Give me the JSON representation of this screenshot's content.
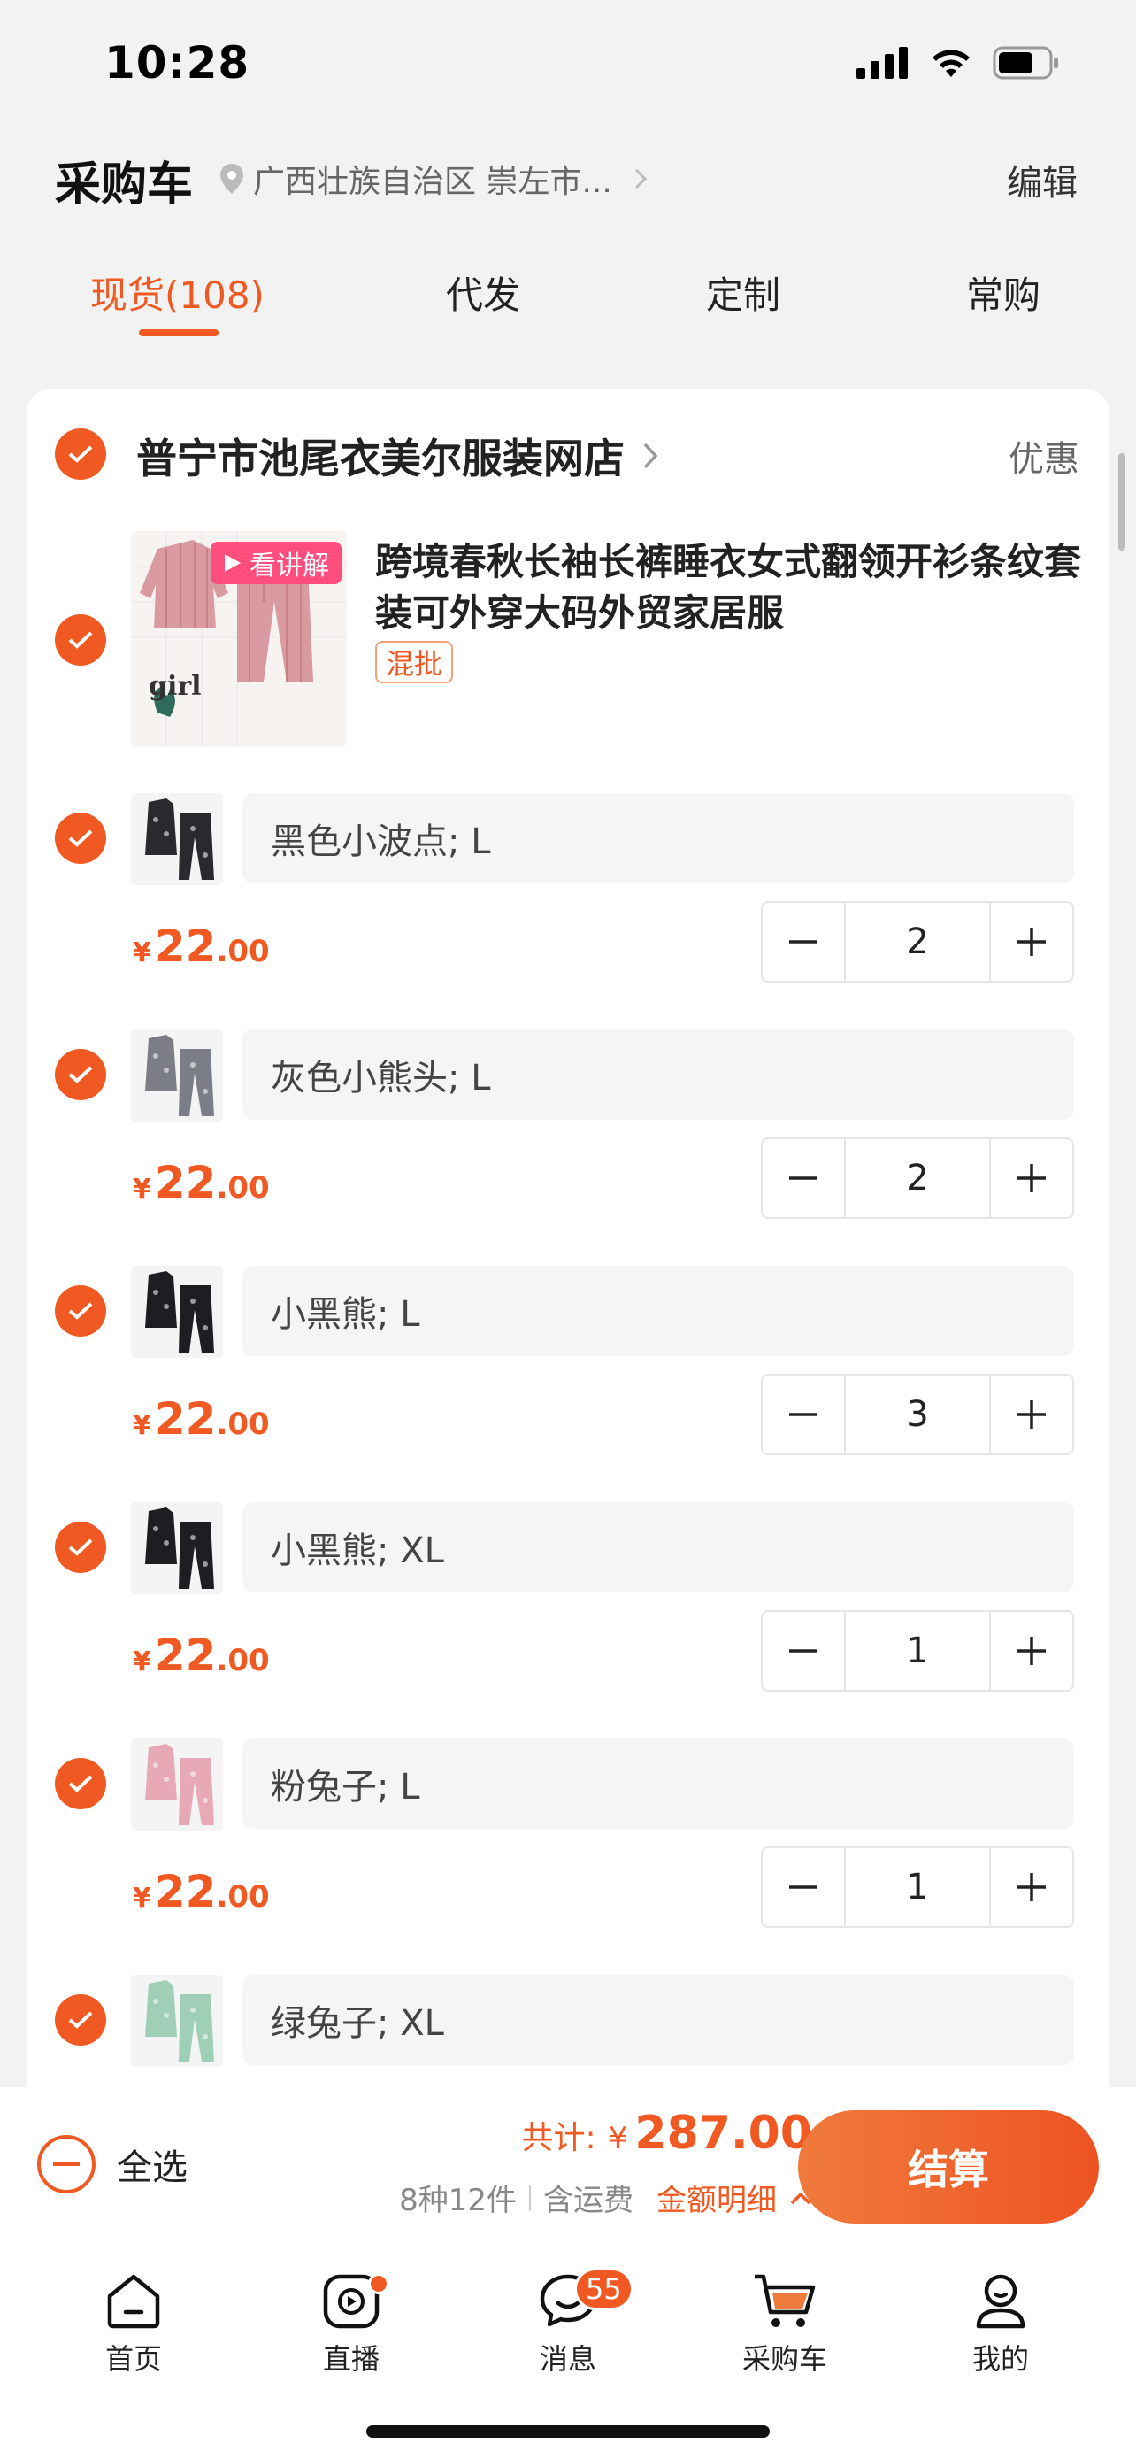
{
  "status": {
    "time": "10:28"
  },
  "header": {
    "title": "采购车",
    "location": "广西壮族自治区 崇左市...",
    "edit": "编辑"
  },
  "tabs": [
    "现货(108)",
    "代发",
    "定制",
    "常购"
  ],
  "shop": {
    "name": "普宁市池尾衣美尔服装网店",
    "coupon": "优惠"
  },
  "product": {
    "title": "跨境春秋长袖长裤睡衣女式翻领开衫条纹套装可外穿大码外贸家居服",
    "badge": "看讲解",
    "tag": "混批",
    "image_text": "girl"
  },
  "skus": [
    {
      "label": "黑色小波点; L",
      "yen": "¥",
      "price_int": "22",
      "price_dec": ".00",
      "qty": "2",
      "thumb_color": "#2a2a2e"
    },
    {
      "label": "灰色小熊头; L",
      "yen": "¥",
      "price_int": "22",
      "price_dec": ".00",
      "qty": "2",
      "thumb_color": "#7b7e86"
    },
    {
      "label": "小黑熊; L",
      "yen": "¥",
      "price_int": "22",
      "price_dec": ".00",
      "qty": "3",
      "thumb_color": "#1e1e22"
    },
    {
      "label": "小黑熊; XL",
      "yen": "¥",
      "price_int": "22",
      "price_dec": ".00",
      "qty": "1",
      "thumb_color": "#1e1e22"
    },
    {
      "label": "粉兔子; L",
      "yen": "¥",
      "price_int": "22",
      "price_dec": ".00",
      "qty": "1",
      "thumb_color": "#e7a9b6"
    },
    {
      "label": "绿兔子; XL",
      "thumb_color": "#9fcfb6"
    }
  ],
  "footer": {
    "select_all": "全选",
    "total_label": "共计:",
    "total_yen": "¥",
    "total_amount": "287.00",
    "count": "8种12件",
    "shipping": "含运费",
    "detail": "金额明细",
    "checkout": "结算"
  },
  "tabbar": [
    {
      "label": "首页",
      "icon": "home-icon"
    },
    {
      "label": "直播",
      "icon": "live-icon"
    },
    {
      "label": "消息",
      "icon": "message-icon",
      "badge": "55"
    },
    {
      "label": "采购车",
      "icon": "cart-icon"
    },
    {
      "label": "我的",
      "icon": "profile-icon"
    }
  ],
  "colors": {
    "accent": "#f05a22",
    "background": "#f2f2f2"
  }
}
